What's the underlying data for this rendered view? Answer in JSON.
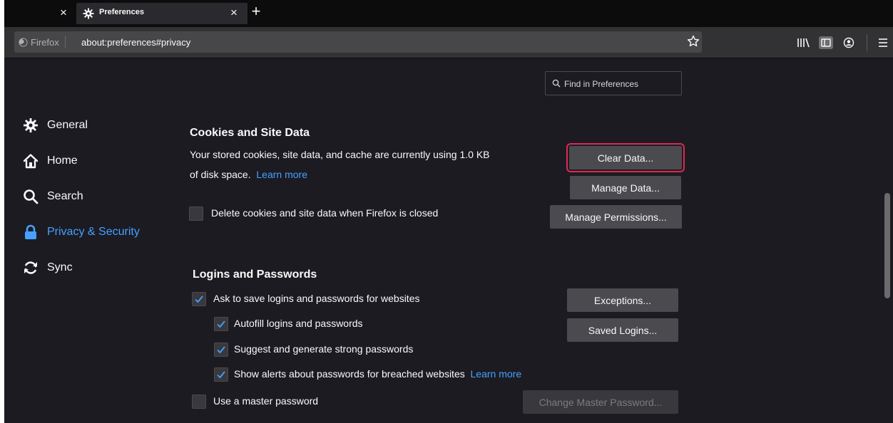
{
  "tabs": {
    "active_title": "Preferences",
    "prev_close": "×",
    "close": "×",
    "new_tab": "+"
  },
  "urlbar": {
    "identity_label": "Firefox",
    "url": "about:preferences#privacy"
  },
  "search": {
    "placeholder": "Find in Preferences"
  },
  "sidebar": {
    "items": [
      {
        "label": "General",
        "icon": "gear-icon"
      },
      {
        "label": "Home",
        "icon": "home-icon"
      },
      {
        "label": "Search",
        "icon": "search-icon"
      },
      {
        "label": "Privacy & Security",
        "icon": "lock-icon",
        "selected": true
      },
      {
        "label": "Sync",
        "icon": "sync-icon"
      }
    ]
  },
  "cookies": {
    "title": "Cookies and Site Data",
    "description_1": "Your stored cookies, site data, and cache are currently using 1.0 KB",
    "description_2": "of disk space.",
    "learn_more": "Learn more",
    "delete_on_close": "Delete cookies and site data when Firefox is closed",
    "delete_on_close_checked": false,
    "clear_data": "Clear Data...",
    "manage_data": "Manage Data...",
    "manage_permissions": "Manage Permissions..."
  },
  "logins": {
    "title": "Logins and Passwords",
    "ask_to_save": "Ask to save logins and passwords for websites",
    "autofill": "Autofill logins and passwords",
    "suggest": "Suggest and generate strong passwords",
    "breach_alerts": "Show alerts about passwords for breached websites",
    "breach_learn_more": "Learn more",
    "master_password": "Use a master password",
    "exceptions": "Exceptions...",
    "saved_logins": "Saved Logins...",
    "change_master": "Change Master Password..."
  },
  "colors": {
    "accent": "#45a1ff",
    "focus_outline": "#e22850",
    "background": "#1c1b22"
  }
}
